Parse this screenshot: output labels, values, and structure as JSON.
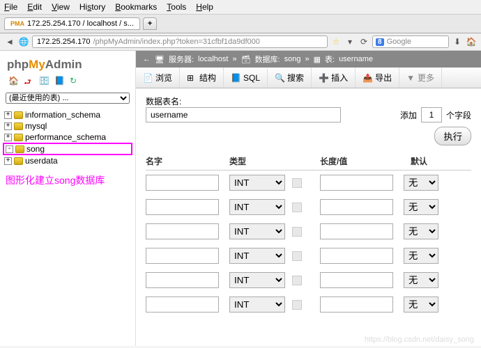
{
  "menubar": [
    "File",
    "Edit",
    "View",
    "History",
    "Bookmarks",
    "Tools",
    "Help"
  ],
  "tab": {
    "title": "172.25.254.170 / localhost / s..."
  },
  "url": {
    "host": "172.25.254.170",
    "path": "/phpMyAdmin/index.php?token=31cfbf1da9df000"
  },
  "search": {
    "engine": "8",
    "placeholder": "Google"
  },
  "logo": {
    "p1": "php",
    "p2": "My",
    "p3": "Admin"
  },
  "recent": {
    "label": "(最近使用的表) ..."
  },
  "tree": {
    "items": [
      {
        "name": "information_schema",
        "toggle": "+"
      },
      {
        "name": "mysql",
        "toggle": "+"
      },
      {
        "name": "performance_schema",
        "toggle": "+"
      },
      {
        "name": "song",
        "toggle": "-",
        "hl": true
      },
      {
        "name": "userdata",
        "toggle": "+"
      }
    ]
  },
  "annotation": "图形化建立song数据库",
  "breadcrumb": {
    "server_lbl": "服务器:",
    "server": "localhost",
    "db_lbl": "数据库:",
    "db": "song",
    "tbl_lbl": "表:",
    "tbl": "username"
  },
  "tabs": [
    {
      "icon": "📄",
      "label": "浏览"
    },
    {
      "icon": "⊞",
      "label": "结构"
    },
    {
      "icon": "📘",
      "label": "SQL"
    },
    {
      "icon": "🔍",
      "label": "搜索"
    },
    {
      "icon": "➕",
      "label": "插入"
    },
    {
      "icon": "📤",
      "label": "导出"
    }
  ],
  "more": "更多",
  "form": {
    "tablename_label": "数据表名:",
    "tablename_value": "username",
    "add_label": "添加",
    "add_count": "1",
    "fields_label": "个字段",
    "exec_label": "执行"
  },
  "columns": {
    "headers": {
      "name": "名字",
      "type": "类型",
      "len": "长度/值",
      "def": "默认"
    },
    "type_default": "INT",
    "def_default": "无",
    "count": 6
  },
  "watermark": "https://blog.csdn.net/daisy_song"
}
